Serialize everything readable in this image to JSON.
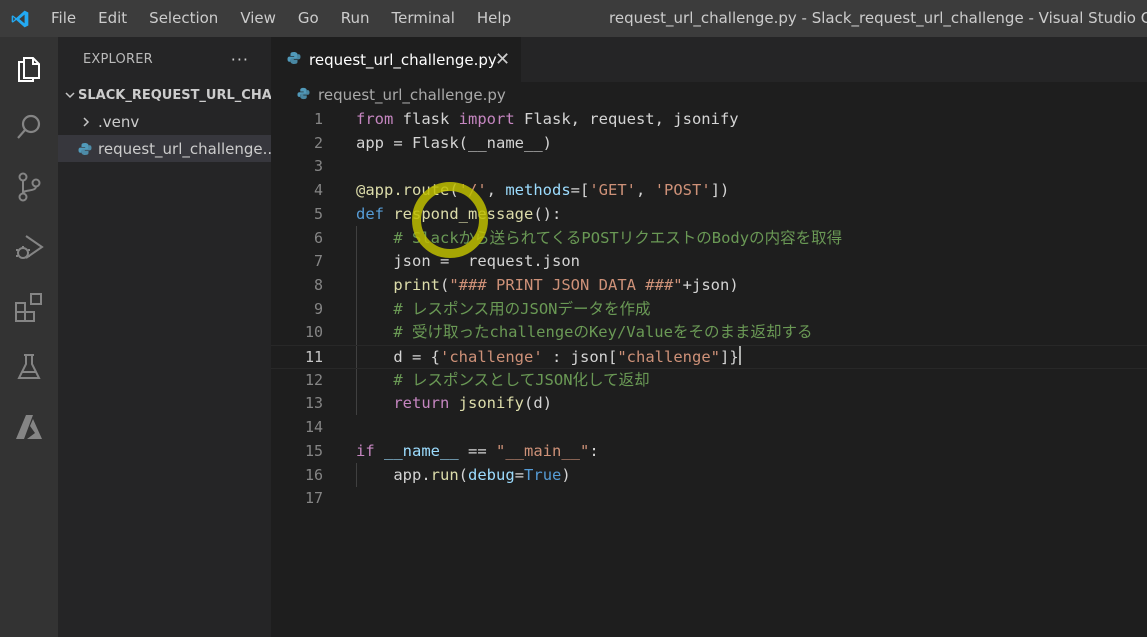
{
  "titlebar": {
    "menu": [
      "File",
      "Edit",
      "Selection",
      "View",
      "Go",
      "Run",
      "Terminal",
      "Help"
    ],
    "window_title": "request_url_challenge.py - Slack_request_url_challenge - Visual Studio Code"
  },
  "activitybar": {
    "items": [
      "explorer-icon",
      "search-icon",
      "source-control-icon",
      "run-debug-icon",
      "extensions-icon",
      "testing-icon",
      "azure-icon"
    ]
  },
  "sidebar": {
    "title": "EXPLORER",
    "more": "···",
    "folder": "SLACK_REQUEST_URL_CHA...",
    "items": [
      {
        "label": ".venv",
        "icon": "chevron-right-icon"
      },
      {
        "label": "request_url_challenge...",
        "icon": "python-icon"
      }
    ]
  },
  "tab": {
    "label": "request_url_challenge.py",
    "close": "✕"
  },
  "breadcrumb": {
    "file": "request_url_challenge.py"
  },
  "editor": {
    "current_line": 11,
    "line_numbers": [
      "1",
      "2",
      "3",
      "4",
      "5",
      "6",
      "7",
      "8",
      "9",
      "10",
      "11",
      "12",
      "13",
      "14",
      "15",
      "16",
      "17"
    ],
    "lines": [
      [
        "from",
        " flask ",
        "import",
        " Flask, request, jsonify"
      ],
      [
        "app",
        " = ",
        "Flask",
        "(",
        "__name__",
        ")"
      ],
      [],
      [
        "@app.route",
        "(",
        "'/'",
        ", ",
        "methods",
        "=[",
        "'GET'",
        ", ",
        "'POST'",
        "])"
      ],
      [
        "def",
        " ",
        "respond_message",
        "():"
      ],
      [
        "    ",
        "# Slackから送られてくるPOSTリクエストのBodyの内容を取得"
      ],
      [
        "    ",
        "json",
        " =  ",
        "request",
        ".",
        "json"
      ],
      [
        "    ",
        "print",
        "(",
        "\"### PRINT JSON DATA ###\"",
        "+",
        "json",
        ")"
      ],
      [
        "    ",
        "# レスポンス用のJSONデータを作成"
      ],
      [
        "    ",
        "# 受け取ったchallengeのKey/Valueをそのまま返却する"
      ],
      [
        "    ",
        "d",
        " = {",
        "'challenge'",
        " : ",
        "json",
        "[",
        "\"challenge\"",
        "]}"
      ],
      [
        "    ",
        "# レスポンスとしてJSON化して返却"
      ],
      [
        "    ",
        "return",
        " ",
        "jsonify",
        "(",
        "d",
        ")"
      ],
      [],
      [
        "if",
        " ",
        "__name__",
        " == ",
        "\"__main__\"",
        ":"
      ],
      [
        "    ",
        "app",
        ".",
        "run",
        "(",
        "debug",
        "=",
        "True",
        ")"
      ],
      []
    ]
  },
  "colors": {
    "keyword": "#c586c0",
    "storage": "#569cd6",
    "function": "#dcdcaa",
    "string": "#ce9178",
    "comment": "#6a9955",
    "variable": "#9cdcfe",
    "class": "#4ec9b0",
    "click_highlight": "#bebe00"
  }
}
